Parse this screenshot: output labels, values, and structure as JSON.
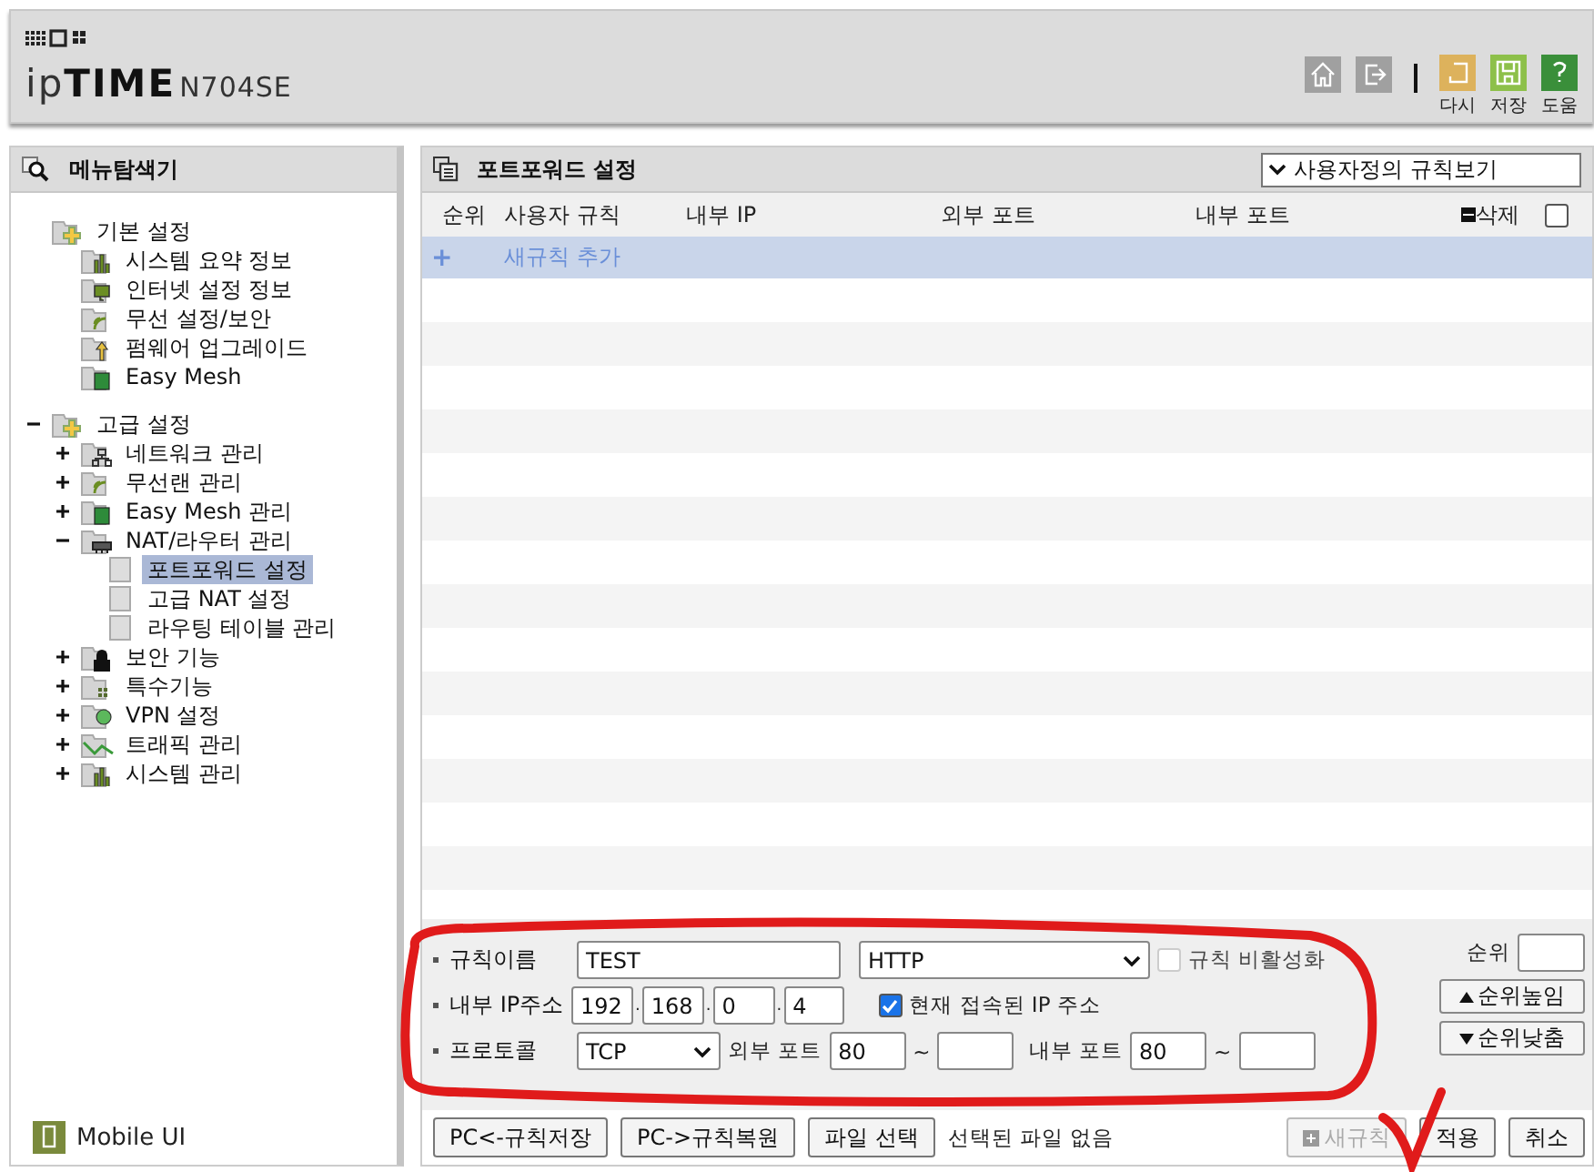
{
  "header": {
    "brand": "ip**TIME**",
    "model": "N704SE",
    "tools": [
      {
        "kind": "home"
      },
      {
        "kind": "logout"
      },
      {
        "kind": "reload",
        "label": "다시"
      },
      {
        "kind": "save",
        "label": "저장"
      },
      {
        "kind": "help",
        "label": "도움"
      }
    ]
  },
  "sidebar": {
    "title": "메뉴탐색기",
    "footer": "Mobile UI",
    "tree": [
      {
        "label": "기본 설정",
        "children": [
          {
            "label": "시스템 요약 정보",
            "selected": false
          },
          {
            "label": "인터넷 설정 정보",
            "selected": false
          },
          {
            "label": "무선 설정/보안",
            "selected": false
          },
          {
            "label": "펌웨어 업그레이드",
            "selected": false
          },
          {
            "label": "Easy Mesh",
            "selected": false
          }
        ]
      },
      {
        "label": "고급 설정",
        "expanded": true,
        "children": [
          {
            "label": "네트워크 관리",
            "expanded": false
          },
          {
            "label": "무선랜 관리",
            "expanded": false
          },
          {
            "label": "Easy Mesh 관리",
            "expanded": false
          },
          {
            "label": "NAT/라우터 관리",
            "expanded": true,
            "children": [
              {
                "label": "포트포워드 설정",
                "selected": true
              },
              {
                "label": "고급 NAT 설정",
                "selected": false
              },
              {
                "label": "라우팅 테이블 관리",
                "selected": false
              }
            ]
          },
          {
            "label": "보안 기능",
            "expanded": false
          },
          {
            "label": "특수기능",
            "expanded": false
          },
          {
            "label": "VPN 설정",
            "expanded": false
          },
          {
            "label": "트래픽 관리",
            "expanded": false
          },
          {
            "label": "시스템 관리",
            "expanded": false
          }
        ]
      }
    ]
  },
  "panel": {
    "title": "포트포워드 설정",
    "view_select": "사용자정의 규칙보기",
    "table": {
      "columns": [
        "순위",
        "사용자 규칙",
        "내부 IP",
        "외부 포트",
        "내부 포트"
      ],
      "delete_label": "삭제",
      "select_all_checked": false,
      "add_row": {
        "plus": "+",
        "label": "새규칙 추가"
      }
    },
    "form": {
      "name": {
        "label": "규칙이름",
        "value": "TEST",
        "service": "HTTP",
        "disable_label": "규칙 비활성화",
        "disable_checked": false
      },
      "ip": {
        "label": "내부 IP주소",
        "octets": [
          "192",
          "168",
          "0",
          "4"
        ],
        "separator": ".",
        "current_label": "현재 접속된 IP 주소",
        "current_checked": true
      },
      "protocol": {
        "label": "프로토콜",
        "value": "TCP",
        "ext_label": "외부 포트",
        "ext_from": "80",
        "tilde": "~",
        "int_label": "내부 포트",
        "int_from": "80"
      },
      "order": {
        "label": "순위",
        "up": "순위높임",
        "down": "순위낮춤"
      }
    },
    "buttons": {
      "left": [
        "PC<-규칙저장",
        "PC->규칙복원"
      ],
      "file_button": "파일 선택",
      "file_status": "선택된 파일 없음",
      "new_rule": {
        "label": "새규칙",
        "disabled": true
      },
      "apply": "적용",
      "cancel": "취소"
    }
  }
}
